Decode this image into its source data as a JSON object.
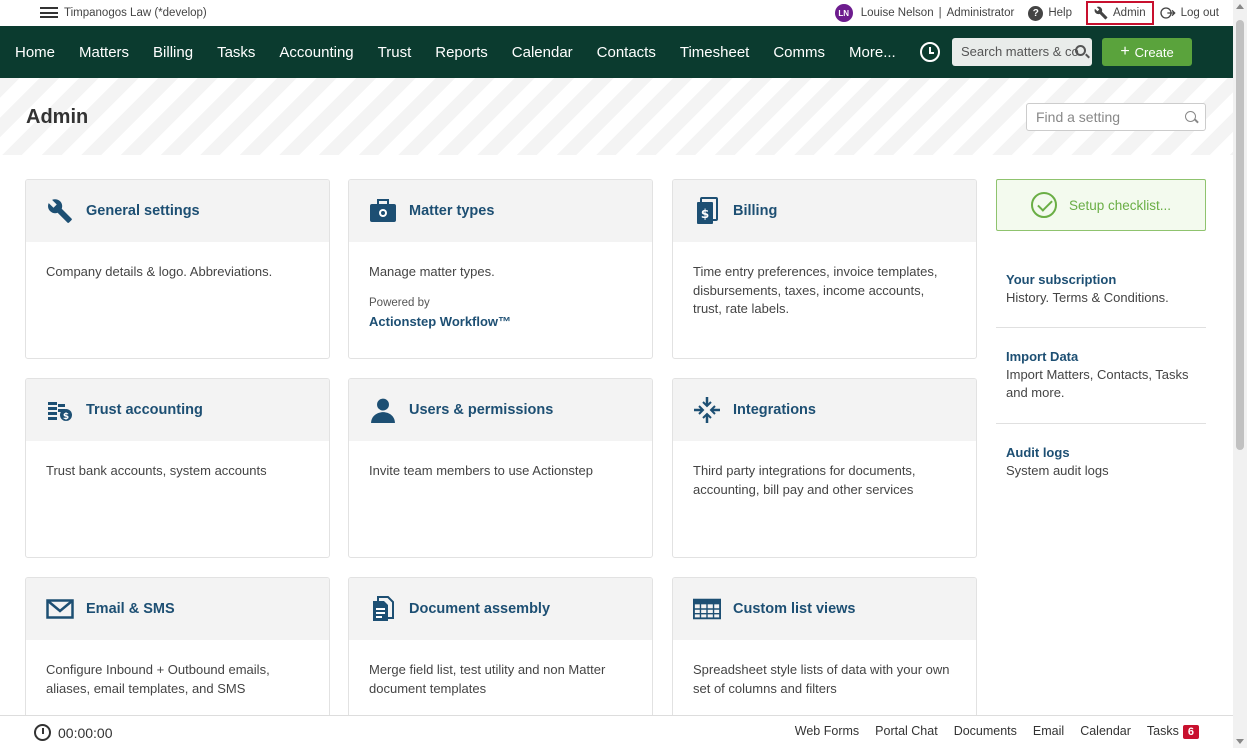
{
  "topbar": {
    "org_name": "Timpanogos Law (*develop)",
    "avatar_initials": "LN",
    "user_name": "Louise Nelson",
    "user_role": "Administrator",
    "help_label": "Help",
    "admin_label": "Admin",
    "logout_label": "Log out"
  },
  "nav": {
    "items": [
      "Home",
      "Matters",
      "Billing",
      "Tasks",
      "Accounting",
      "Trust",
      "Reports",
      "Calendar",
      "Contacts",
      "Timesheet",
      "Comms",
      "More..."
    ],
    "search_placeholder": "Search matters & co",
    "create_label": "Create"
  },
  "header": {
    "title": "Admin",
    "find_placeholder": "Find a setting"
  },
  "cards": [
    {
      "title": "General settings",
      "description": "Company details & logo. Abbreviations.",
      "icon": "wrench-icon"
    },
    {
      "title": "Matter types",
      "description": "Manage matter types.",
      "powered_by": "Powered by",
      "workflow": "Actionstep Workflow™",
      "icon": "toolbox-icon"
    },
    {
      "title": "Billing",
      "description": "Time entry preferences, invoice templates, disbursements, taxes, income accounts, trust, rate labels.",
      "icon": "invoice-icon"
    },
    {
      "title": "Trust accounting",
      "description": "Trust bank accounts, system accounts",
      "icon": "coins-icon"
    },
    {
      "title": "Users & permissions",
      "description": "Invite team members to use Actionstep",
      "icon": "user-icon"
    },
    {
      "title": "Integrations",
      "description": "Third party integrations for documents, accounting, bill pay and other services",
      "icon": "integrations-icon"
    },
    {
      "title": "Email & SMS",
      "description": "Configure Inbound + Outbound emails, aliases, email templates, and SMS",
      "icon": "envelope-icon"
    },
    {
      "title": "Document assembly",
      "description": "Merge field list, test utility and non Matter document templates",
      "icon": "document-icon"
    },
    {
      "title": "Custom list views",
      "description": "Spreadsheet style lists of data with your own set of columns and filters",
      "icon": "table-icon"
    }
  ],
  "sidebar": {
    "setup_label": "Setup checklist...",
    "links": [
      {
        "title": "Your subscription",
        "description": "History. Terms & Conditions."
      },
      {
        "title": "Import Data",
        "description": "Import Matters, Contacts, Tasks and more."
      },
      {
        "title": "Audit logs",
        "description": "System audit logs"
      }
    ]
  },
  "bottombar": {
    "timer": "00:00:00",
    "links": [
      "Web Forms",
      "Portal Chat",
      "Documents",
      "Email",
      "Calendar",
      "Tasks"
    ],
    "tasks_count": "6"
  },
  "colors": {
    "nav_bg": "#0b3b2f",
    "create_btn": "#5aa33c",
    "link_blue": "#1d4f73",
    "admin_highlight": "#c8102e",
    "setup_green": "#6aae45"
  }
}
